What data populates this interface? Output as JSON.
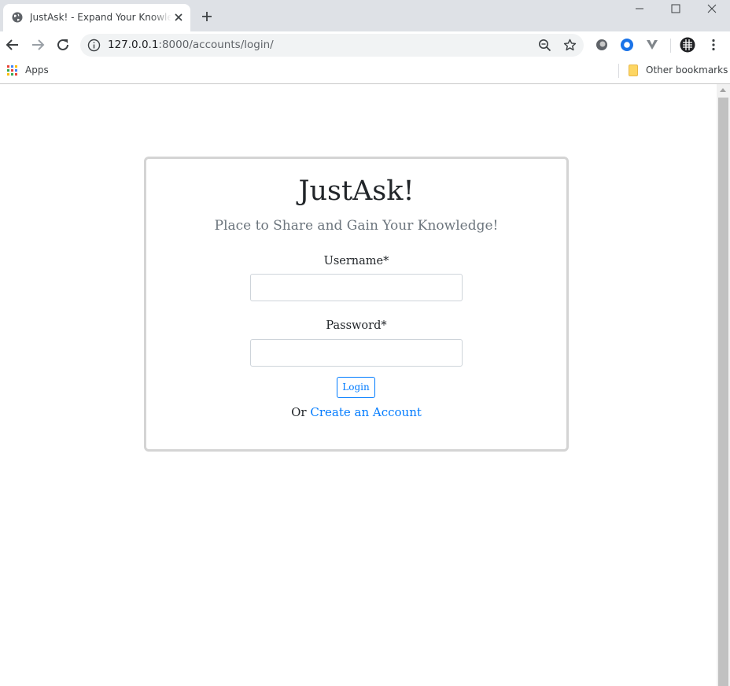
{
  "browser": {
    "tab_title": "JustAsk! - Expand Your Knowledge",
    "url_host": "127.0.0.1",
    "url_rest": ":8000/accounts/login/",
    "bookmarks": {
      "apps_label": "Apps",
      "other_label": "Other bookmarks"
    },
    "icons": [
      "globe-icon",
      "close-icon",
      "plus-icon",
      "minimize-icon",
      "maximize-icon",
      "window-close-icon",
      "back-arrow-icon",
      "forward-arrow-icon",
      "reload-icon",
      "info-icon",
      "zoom-out-icon",
      "star-icon",
      "apps-grid-icon",
      "folder-icon"
    ]
  },
  "page": {
    "brand": "JustAsk!",
    "tagline": "Place to Share and Gain Your Knowledge!",
    "username_label": "Username*",
    "username_value": "",
    "password_label": "Password*",
    "password_value": "",
    "login_label": "Login",
    "or_text": "Or ",
    "create_account_label": "Create an Account"
  },
  "colors": {
    "accent": "#007bff",
    "tabstrip": "#dee1e6",
    "card_border": "#d4d4d4",
    "muted_text": "#6c757d"
  }
}
